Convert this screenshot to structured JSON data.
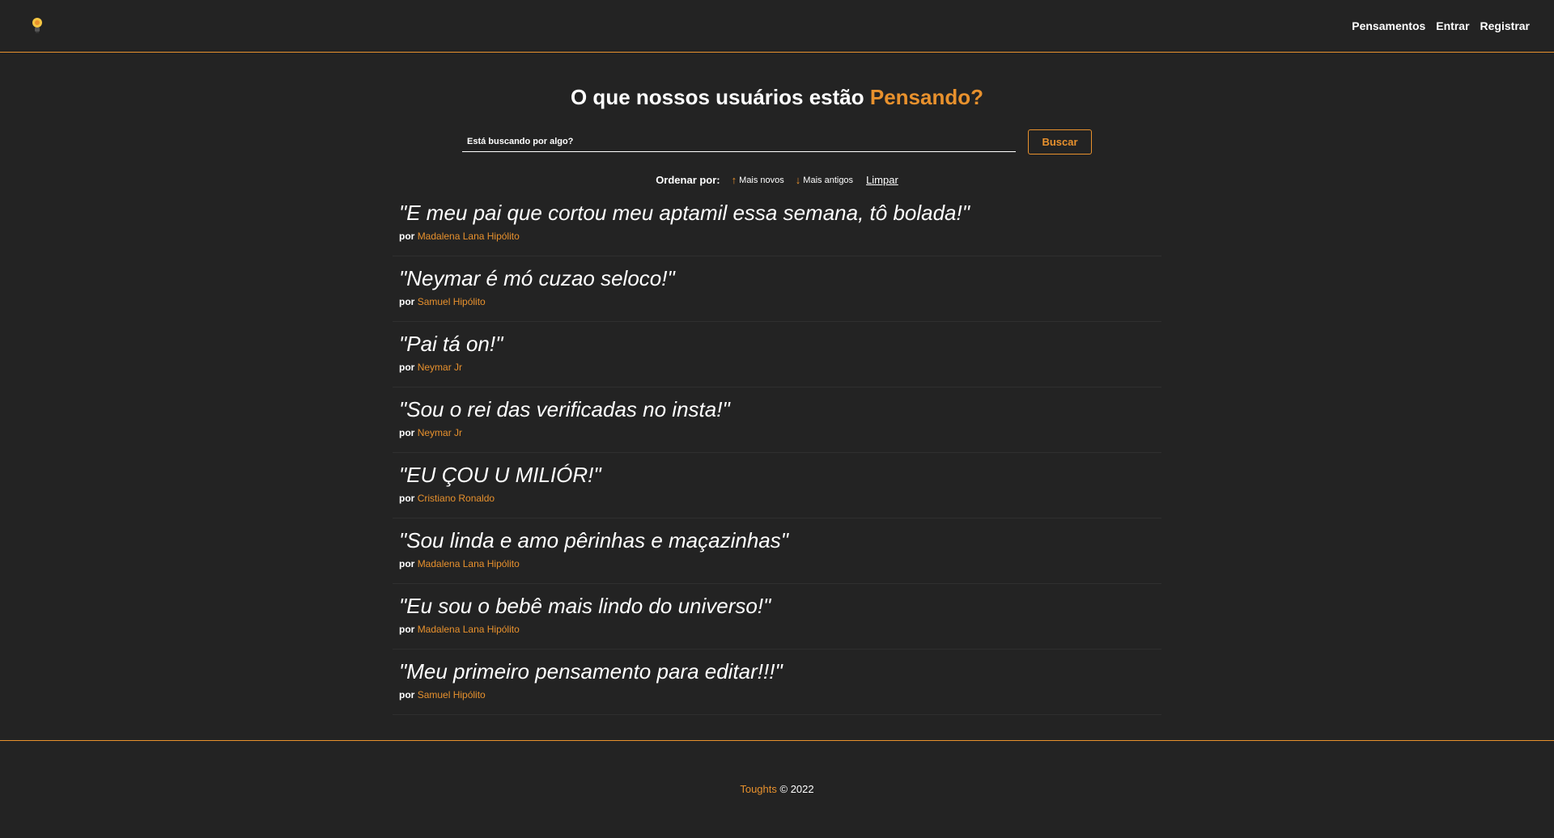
{
  "navbar": {
    "links": [
      {
        "label": "Pensamentos"
      },
      {
        "label": "Entrar"
      },
      {
        "label": "Registrar"
      }
    ]
  },
  "hero": {
    "title_main": "O que nossos usuários estão ",
    "title_accent": "Pensando?"
  },
  "search": {
    "placeholder": "Está buscando por algo?",
    "value": "",
    "button_label": "Buscar"
  },
  "order": {
    "label": "Ordenar por:",
    "newest_label": "Mais novos",
    "oldest_label": "Mais antigos",
    "clear_label": "Limpar"
  },
  "thoughts": [
    {
      "text": "\"E meu pai que cortou meu aptamil essa semana, tô bolada!\"",
      "by": "por",
      "author": "Madalena Lana Hipólito"
    },
    {
      "text": "\"Neymar é mó cuzao seloco!\"",
      "by": "por",
      "author": "Samuel Hipólito"
    },
    {
      "text": "\"Pai tá on!\"",
      "by": "por",
      "author": "Neymar Jr"
    },
    {
      "text": "\"Sou o rei das verificadas no insta!\"",
      "by": "por",
      "author": "Neymar Jr"
    },
    {
      "text": "\"EU ÇOU U MILIÓR!\"",
      "by": "por",
      "author": "Cristiano Ronaldo"
    },
    {
      "text": "\"Sou linda e amo pêrinhas e maçazinhas\"",
      "by": "por",
      "author": "Madalena Lana Hipólito"
    },
    {
      "text": "\"Eu sou o bebê mais lindo do universo!\"",
      "by": "por",
      "author": "Madalena Lana Hipólito"
    },
    {
      "text": "\"Meu primeiro pensamento para editar!!!\"",
      "by": "por",
      "author": "Samuel Hipólito"
    }
  ],
  "footer": {
    "brand": "Toughts",
    "copyright": "© 2022"
  },
  "colors": {
    "accent": "#e8912d",
    "background": "#232323"
  }
}
